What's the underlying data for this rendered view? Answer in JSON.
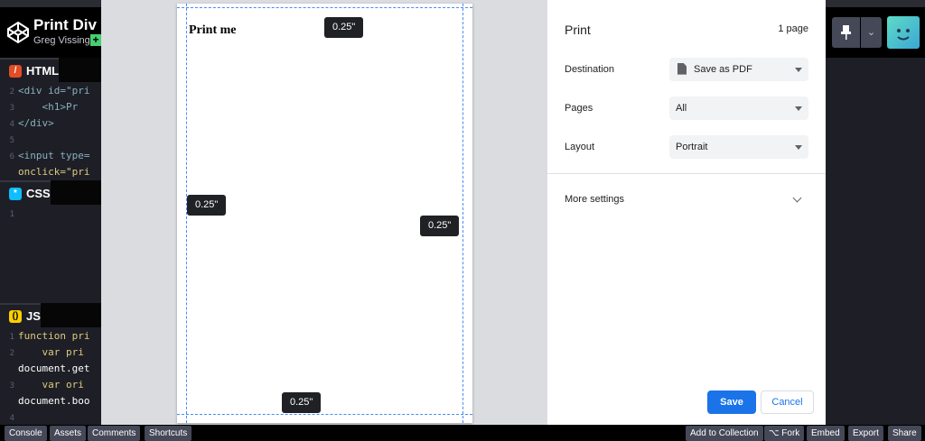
{
  "codepen": {
    "pen_title": "Print Div ar",
    "author": "Greg Vissing",
    "follow_glyph": "+",
    "panels": {
      "html": {
        "label": "HTML",
        "lines": [
          {
            "num": "2",
            "text": "<div id=\"pri"
          },
          {
            "num": "3",
            "text": "    <h1>Pr"
          },
          {
            "num": "4",
            "text": "</div>"
          },
          {
            "num": "5",
            "text": ""
          },
          {
            "num": "6",
            "text": "<input type="
          },
          {
            "num": "",
            "text": "onclick=\"pri"
          }
        ]
      },
      "css": {
        "label": "CSS",
        "lines": [
          {
            "num": "1",
            "text": ""
          }
        ]
      },
      "js": {
        "label": "JS",
        "lines": [
          {
            "num": "1",
            "text": "function pri"
          },
          {
            "num": "2",
            "text": "    var pri"
          },
          {
            "num": "",
            "text": "document.get"
          },
          {
            "num": "3",
            "text": "    var ori"
          },
          {
            "num": "",
            "text": "document.boo"
          },
          {
            "num": "4",
            "text": ""
          }
        ]
      }
    },
    "footer_left": [
      "Console",
      "Assets",
      "Comments",
      "Shortcuts"
    ],
    "footer_right": [
      "Add to Collection",
      "⌥ Fork",
      "Embed",
      "Export",
      "Share"
    ]
  },
  "preview": {
    "heading": "Print me",
    "margin_tips": [
      "0.25\"",
      "0.25\"",
      "0.25\"",
      "0.25\""
    ]
  },
  "print_dialog": {
    "title": "Print",
    "page_count": "1 page",
    "destination_label": "Destination",
    "destination_value": "Save as PDF",
    "pages_label": "Pages",
    "pages_value": "All",
    "layout_label": "Layout",
    "layout_value": "Portrait",
    "more_settings": "More settings",
    "save": "Save",
    "cancel": "Cancel",
    "accent": "#1a73e8"
  }
}
